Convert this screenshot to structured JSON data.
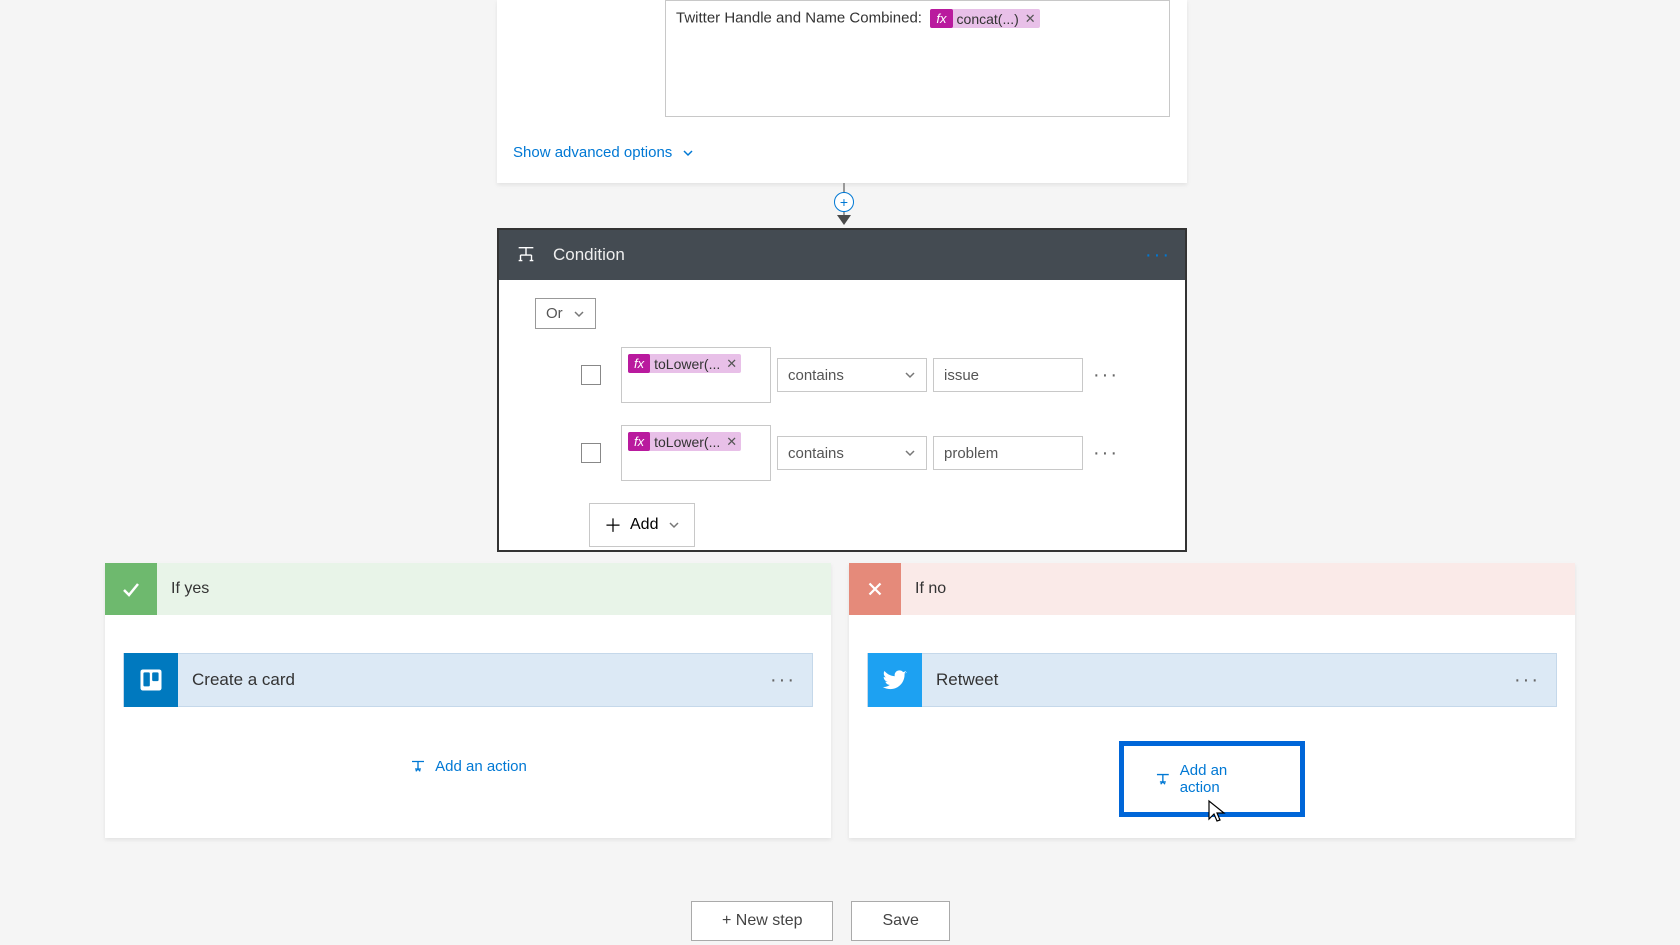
{
  "top_card": {
    "label": "Twitter Handle and Name Combined:",
    "chip": "concat(...)",
    "show_advanced": "Show advanced options"
  },
  "condition": {
    "title": "Condition",
    "logic": "Or",
    "rows": [
      {
        "expr": "toLower(...",
        "operator": "contains",
        "value": "issue"
      },
      {
        "expr": "toLower(...",
        "operator": "contains",
        "value": "problem"
      }
    ],
    "add_label": "Add"
  },
  "branches": {
    "yes": {
      "title": "If yes",
      "action": "Create a card",
      "add_action": "Add an action"
    },
    "no": {
      "title": "If no",
      "action": "Retweet",
      "add_action": "Add an action"
    }
  },
  "footer": {
    "new_step": "+ New step",
    "save": "Save"
  }
}
